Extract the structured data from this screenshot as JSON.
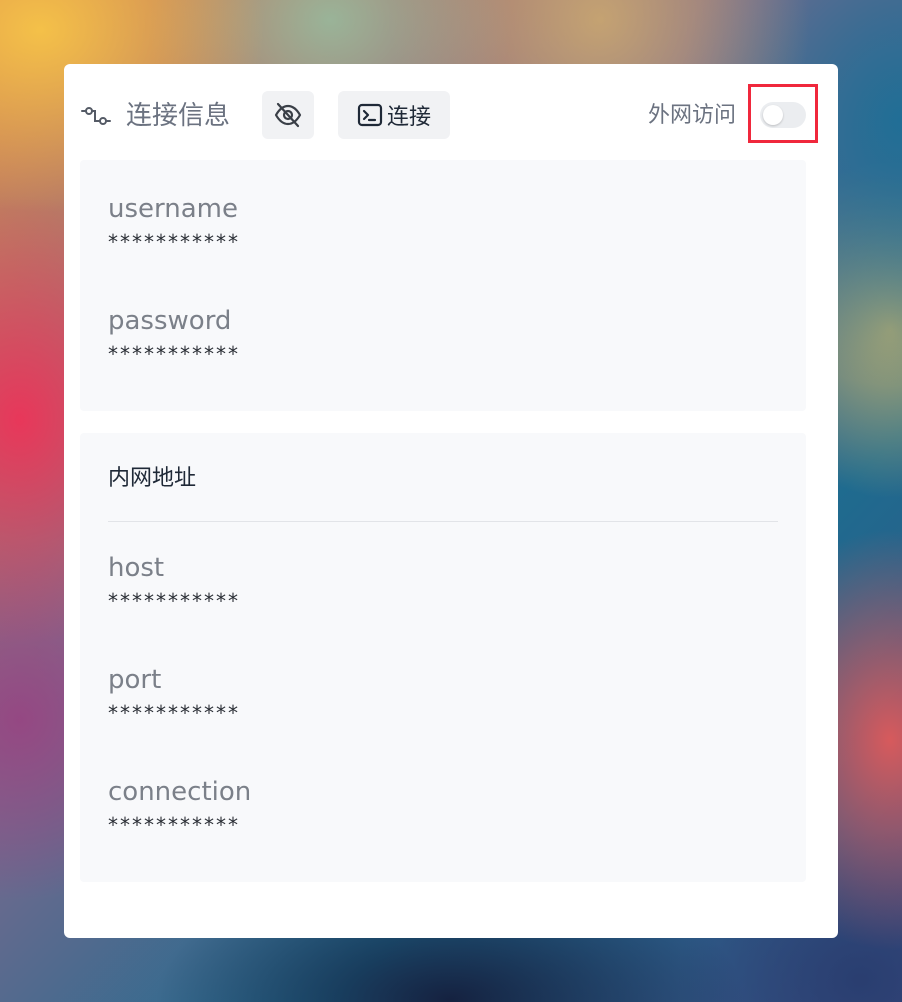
{
  "header": {
    "title": "连接信息",
    "link_icon": "link-plug-icon",
    "visibility_icon": "eye-off-icon",
    "connect_icon": "terminal-icon",
    "connect_label": "连接",
    "external_access_label": "外网访问",
    "external_access_enabled": false
  },
  "credentials": [
    {
      "label": "username",
      "value": "***********"
    },
    {
      "label": "password",
      "value": "***********"
    }
  ],
  "internal_network": {
    "title": "内网地址",
    "fields": [
      {
        "label": "host",
        "value": "***********"
      },
      {
        "label": "port",
        "value": "***********"
      },
      {
        "label": "connection",
        "value": "***********"
      }
    ]
  },
  "colors": {
    "highlight": "#f0283c",
    "panel_bg": "#f8f9fb",
    "button_bg": "#f1f2f4"
  }
}
